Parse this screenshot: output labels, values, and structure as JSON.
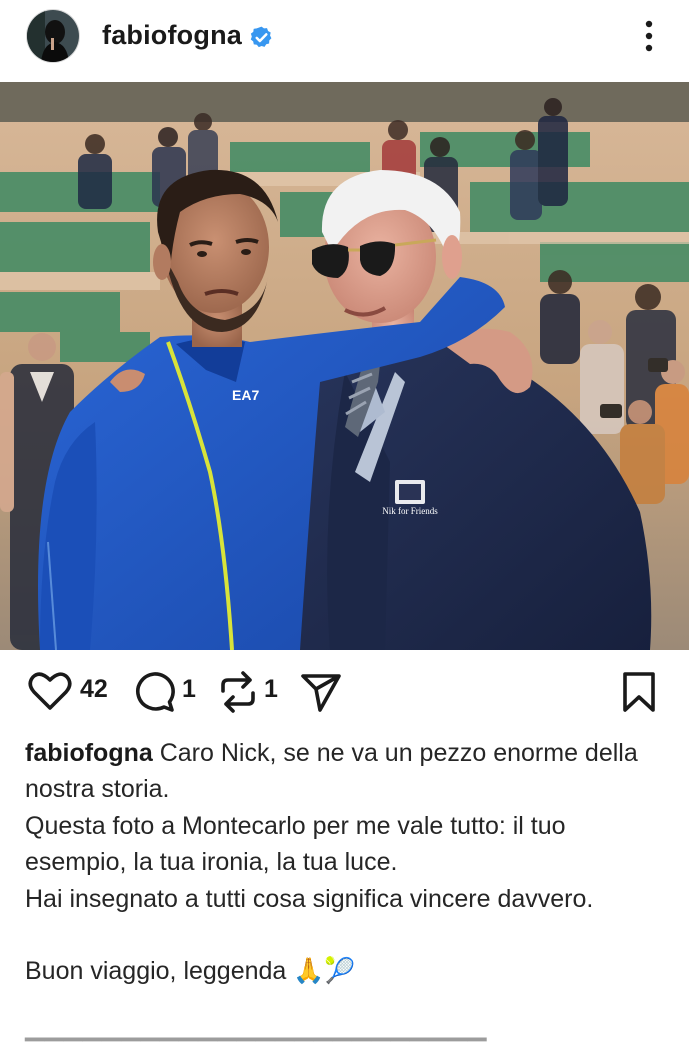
{
  "post": {
    "username": "fabiofogna",
    "verified": true,
    "more_icon": "more-vertical-icon"
  },
  "photo": {
    "jacket_logo": "EA7",
    "badge_text": "Nik for Friends"
  },
  "actions": {
    "likes": "42",
    "comments": "1",
    "reposts": "1",
    "icons": [
      "heart-icon",
      "comment-icon",
      "repost-icon",
      "share-icon",
      "bookmark-icon"
    ]
  },
  "caption": {
    "username": "fabiofogna",
    "lines": [
      " Caro Nick, se ne va un pezzo enorme della nostra storia.",
      "Questa foto a Montecarlo per me vale tutto: il tuo esempio, la tua ironia, la tua luce.",
      "Hai insegnato a tutti cosa significa vincere davvero.",
      "",
      "Buon viaggio, leggenda 🙏🎾"
    ]
  },
  "colors": {
    "verified_blue": "#3897f0",
    "jacket_blue": "#1f55c2",
    "blazer_navy": "#1f2a4c",
    "stadium_green": "#3f8a63"
  }
}
